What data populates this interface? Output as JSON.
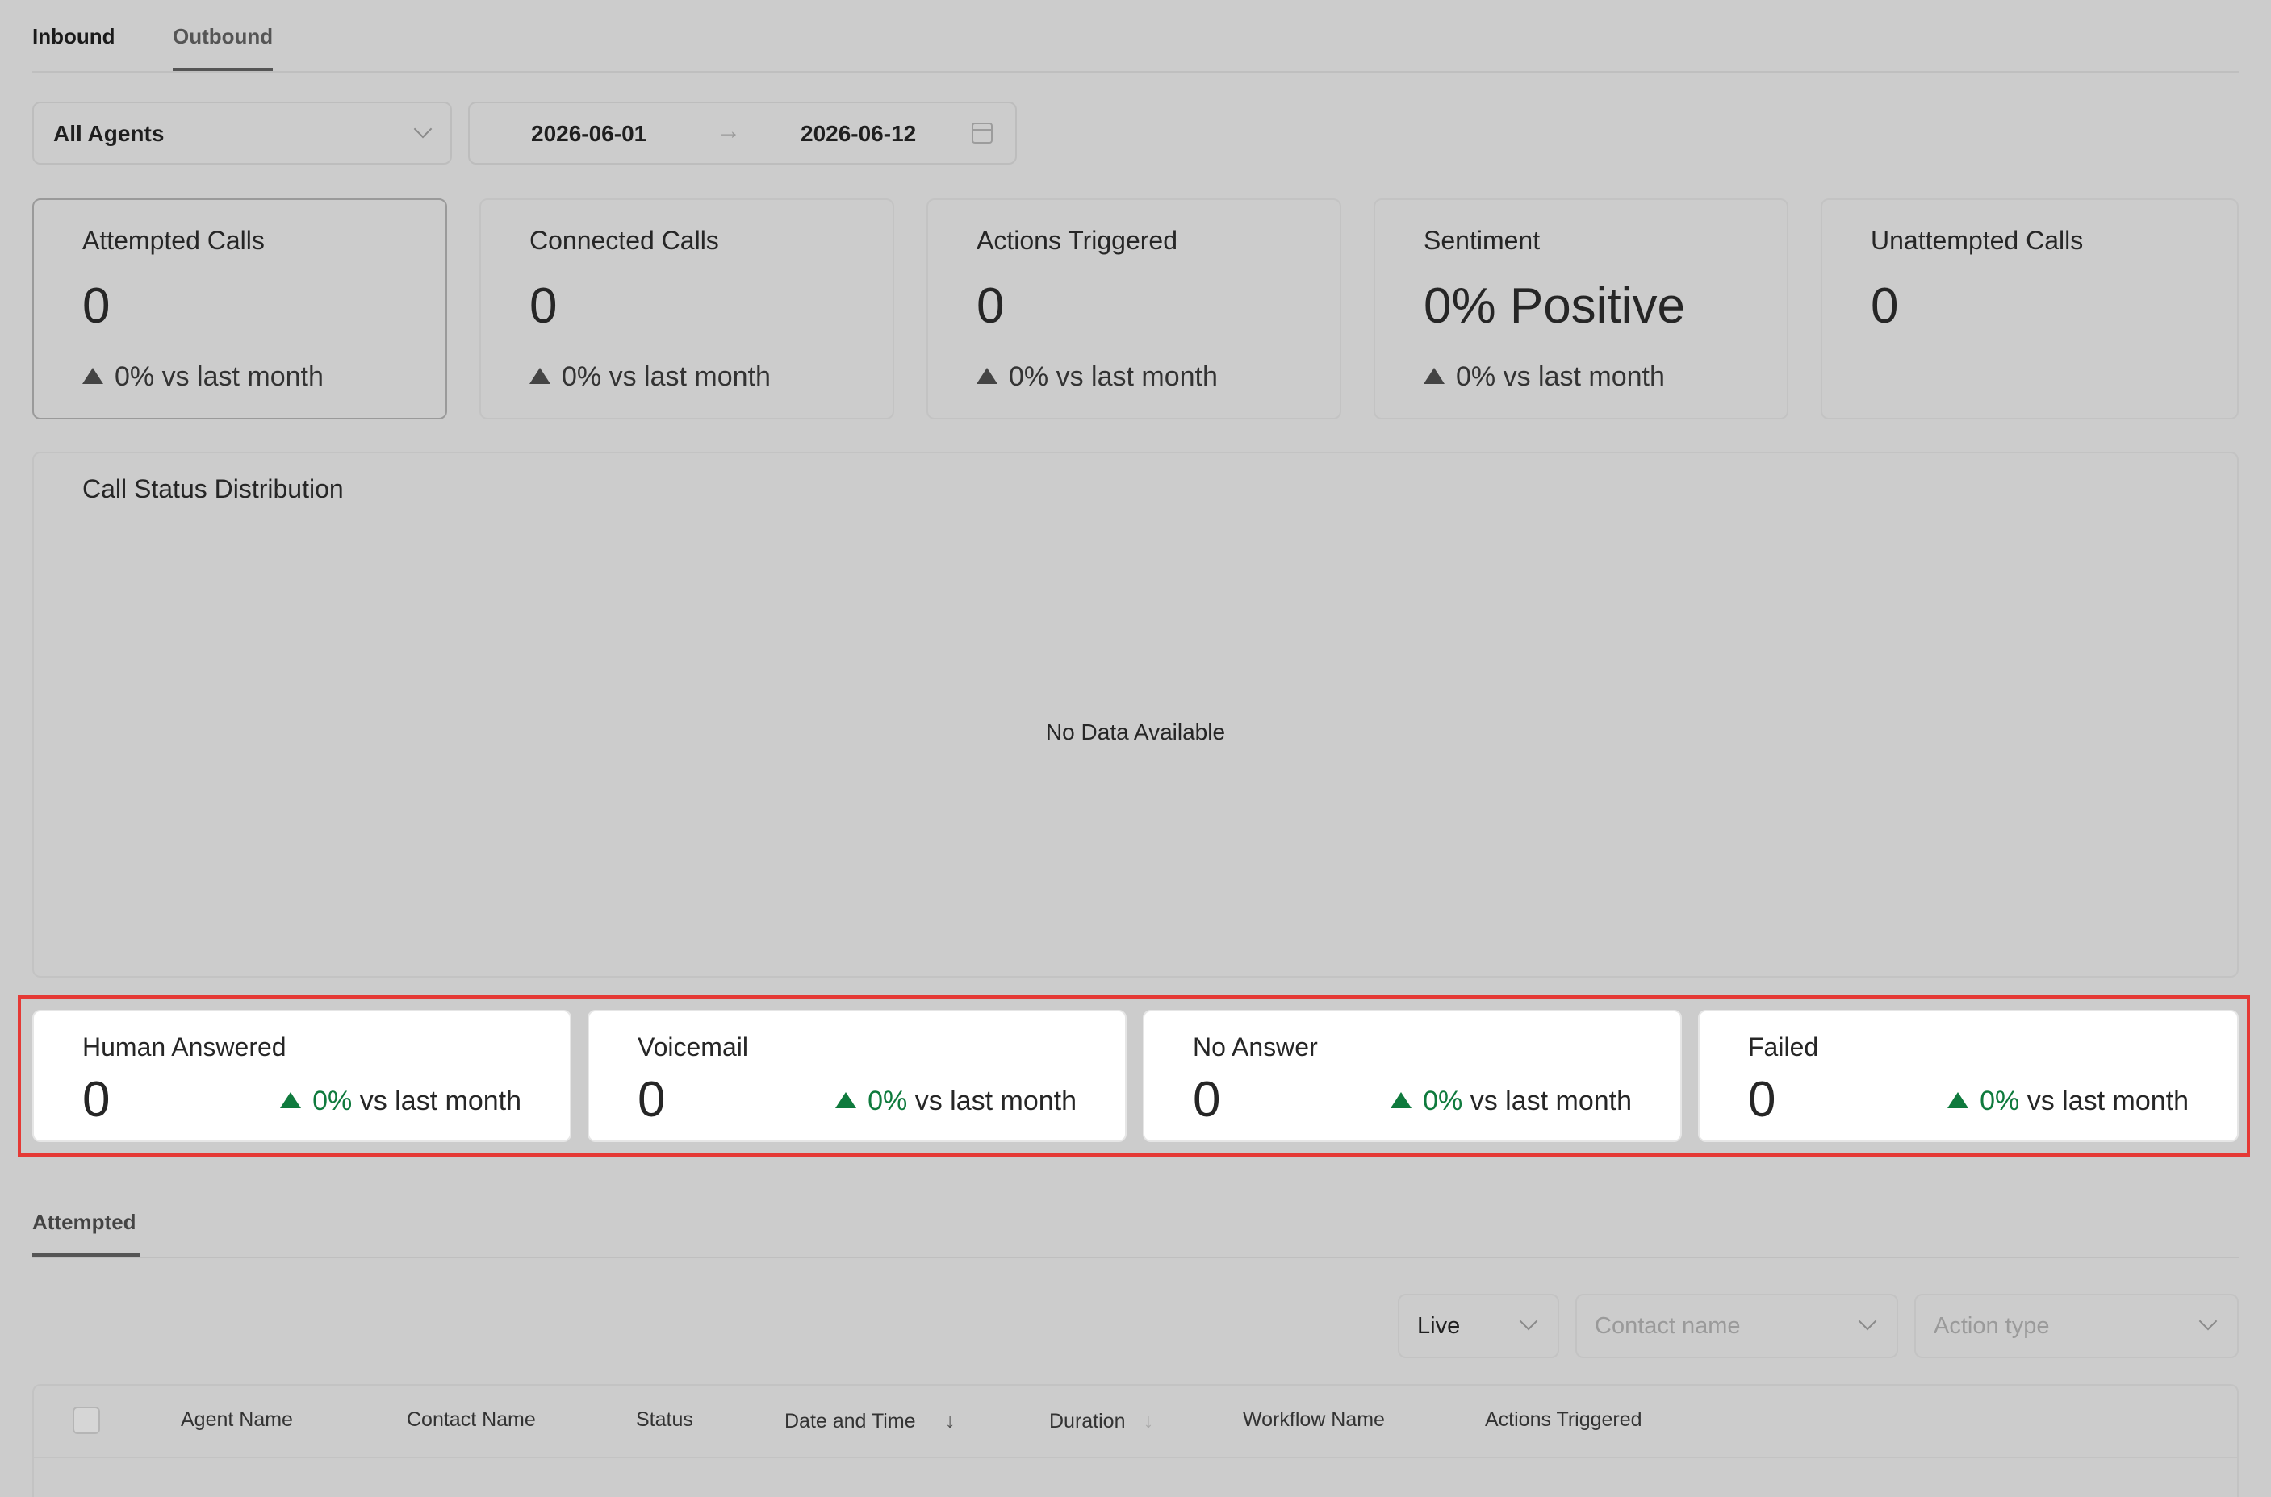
{
  "tabs": {
    "inbound": "Inbound",
    "outbound": "Outbound"
  },
  "filters": {
    "agent": "All Agents",
    "date_start": "2026-06-01",
    "date_end": "2026-06-12",
    "arrow": "→"
  },
  "stats": [
    {
      "title": "Attempted Calls",
      "value": "0",
      "delta": "0% vs last month"
    },
    {
      "title": "Connected Calls",
      "value": "0",
      "delta": "0% vs last month"
    },
    {
      "title": "Actions Triggered",
      "value": "0",
      "delta": "0% vs last month"
    },
    {
      "title": "Sentiment",
      "value": "0% Positive",
      "delta": "0% vs last month"
    },
    {
      "title": "Unattempted Calls",
      "value": "0"
    }
  ],
  "chart": {
    "title": "Call Status Distribution",
    "empty": "No Data Available"
  },
  "status_cards": [
    {
      "title": "Human Answered",
      "value": "0",
      "pct": "0%",
      "suffix": " vs last month"
    },
    {
      "title": "Voicemail",
      "value": "0",
      "pct": "0%",
      "suffix": " vs last month"
    },
    {
      "title": "No Answer",
      "value": "0",
      "pct": "0%",
      "suffix": " vs last month"
    },
    {
      "title": "Failed",
      "value": "0",
      "pct": "0%",
      "suffix": " vs last month"
    }
  ],
  "sub_tab": "Attempted",
  "table_filters": {
    "live": "Live",
    "contact_placeholder": "Contact name",
    "action_placeholder": "Action type"
  },
  "table": {
    "columns": [
      "Agent Name",
      "Contact Name",
      "Status",
      "Date and Time",
      "Duration",
      "Workflow Name",
      "Actions Triggered"
    ],
    "sort_icon": "↓"
  }
}
